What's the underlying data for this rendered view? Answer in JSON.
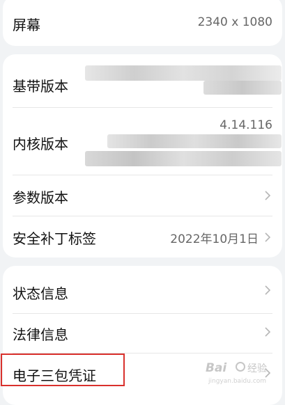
{
  "screen": {
    "label": "屏幕",
    "value": "2340 x 1080"
  },
  "versions": {
    "baseband": {
      "label": "基带版本"
    },
    "kernel": {
      "label": "内核版本",
      "value": "4.14.116"
    },
    "params": {
      "label": "参数版本"
    },
    "security_patch": {
      "label": "安全补丁标签",
      "value": "2022年10月1日"
    }
  },
  "info": {
    "status": {
      "label": "状态信息"
    },
    "legal": {
      "label": "法律信息"
    },
    "warranty": {
      "label": "电子三包凭证"
    }
  },
  "icons": [
    "chevron-right-icon"
  ],
  "colors": {
    "background": "#f1f3f5",
    "card": "#ffffff",
    "highlight": "#d9302c",
    "muted": "#666666"
  }
}
